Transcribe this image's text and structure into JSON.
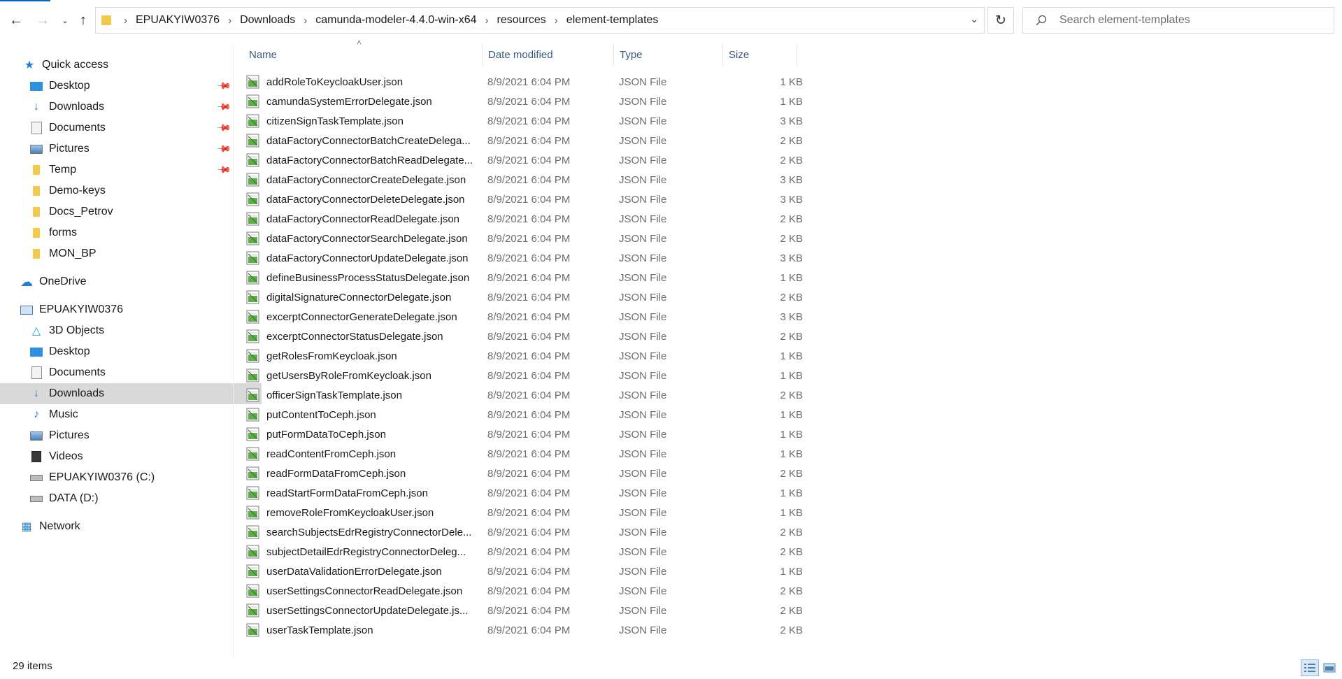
{
  "nav": {
    "back_icon": "arrow-left-icon",
    "forward_icon": "arrow-right-icon",
    "recent_icon": "chevron-down-icon",
    "up_icon": "arrow-up-icon"
  },
  "address": {
    "crumbs": [
      "EPUAKYIW0376",
      "Downloads",
      "camunda-modeler-4.4.0-win-x64",
      "resources",
      "element-templates"
    ]
  },
  "search": {
    "placeholder": "Search element-templates"
  },
  "sidebar": {
    "quick_access": "Quick access",
    "pinned": [
      {
        "label": "Desktop",
        "icon": "desktop-icon"
      },
      {
        "label": "Downloads",
        "icon": "downloads-icon"
      },
      {
        "label": "Documents",
        "icon": "documents-icon"
      },
      {
        "label": "Pictures",
        "icon": "pictures-icon"
      },
      {
        "label": "Temp",
        "icon": "folder-icon"
      }
    ],
    "folders": [
      {
        "label": "Demo-keys"
      },
      {
        "label": "Docs_Petrov"
      },
      {
        "label": "forms"
      },
      {
        "label": "MON_BP"
      }
    ],
    "onedrive": "OneDrive",
    "this_pc": "EPUAKYIW0376",
    "pc_items": [
      {
        "label": "3D Objects",
        "icon": "3d-objects-icon"
      },
      {
        "label": "Desktop",
        "icon": "desktop-icon"
      },
      {
        "label": "Documents",
        "icon": "documents-icon"
      },
      {
        "label": "Downloads",
        "icon": "downloads-icon"
      },
      {
        "label": "Music",
        "icon": "music-icon"
      },
      {
        "label": "Pictures",
        "icon": "pictures-icon"
      },
      {
        "label": "Videos",
        "icon": "videos-icon"
      },
      {
        "label": "EPUAKYIW0376 (C:)",
        "icon": "drive-c-icon"
      },
      {
        "label": "DATA (D:)",
        "icon": "drive-d-icon"
      }
    ],
    "network": "Network"
  },
  "columns": {
    "name": "Name",
    "date": "Date modified",
    "type": "Type",
    "size": "Size"
  },
  "files": [
    {
      "name": "addRoleToKeycloakUser.json",
      "date": "8/9/2021 6:04 PM",
      "type": "JSON File",
      "size": "1 KB"
    },
    {
      "name": "camundaSystemErrorDelegate.json",
      "date": "8/9/2021 6:04 PM",
      "type": "JSON File",
      "size": "1 KB"
    },
    {
      "name": "citizenSignTaskTemplate.json",
      "date": "8/9/2021 6:04 PM",
      "type": "JSON File",
      "size": "3 KB"
    },
    {
      "name": "dataFactoryConnectorBatchCreateDelega...",
      "date": "8/9/2021 6:04 PM",
      "type": "JSON File",
      "size": "2 KB"
    },
    {
      "name": "dataFactoryConnectorBatchReadDelegate...",
      "date": "8/9/2021 6:04 PM",
      "type": "JSON File",
      "size": "2 KB"
    },
    {
      "name": "dataFactoryConnectorCreateDelegate.json",
      "date": "8/9/2021 6:04 PM",
      "type": "JSON File",
      "size": "3 KB"
    },
    {
      "name": "dataFactoryConnectorDeleteDelegate.json",
      "date": "8/9/2021 6:04 PM",
      "type": "JSON File",
      "size": "3 KB"
    },
    {
      "name": "dataFactoryConnectorReadDelegate.json",
      "date": "8/9/2021 6:04 PM",
      "type": "JSON File",
      "size": "2 KB"
    },
    {
      "name": "dataFactoryConnectorSearchDelegate.json",
      "date": "8/9/2021 6:04 PM",
      "type": "JSON File",
      "size": "2 KB"
    },
    {
      "name": "dataFactoryConnectorUpdateDelegate.json",
      "date": "8/9/2021 6:04 PM",
      "type": "JSON File",
      "size": "3 KB"
    },
    {
      "name": "defineBusinessProcessStatusDelegate.json",
      "date": "8/9/2021 6:04 PM",
      "type": "JSON File",
      "size": "1 KB"
    },
    {
      "name": "digitalSignatureConnectorDelegate.json",
      "date": "8/9/2021 6:04 PM",
      "type": "JSON File",
      "size": "2 KB"
    },
    {
      "name": "excerptConnectorGenerateDelegate.json",
      "date": "8/9/2021 6:04 PM",
      "type": "JSON File",
      "size": "3 KB"
    },
    {
      "name": "excerptConnectorStatusDelegate.json",
      "date": "8/9/2021 6:04 PM",
      "type": "JSON File",
      "size": "2 KB"
    },
    {
      "name": "getRolesFromKeycloak.json",
      "date": "8/9/2021 6:04 PM",
      "type": "JSON File",
      "size": "1 KB"
    },
    {
      "name": "getUsersByRoleFromKeycloak.json",
      "date": "8/9/2021 6:04 PM",
      "type": "JSON File",
      "size": "1 KB"
    },
    {
      "name": "officerSignTaskTemplate.json",
      "date": "8/9/2021 6:04 PM",
      "type": "JSON File",
      "size": "2 KB"
    },
    {
      "name": "putContentToCeph.json",
      "date": "8/9/2021 6:04 PM",
      "type": "JSON File",
      "size": "1 KB"
    },
    {
      "name": "putFormDataToCeph.json",
      "date": "8/9/2021 6:04 PM",
      "type": "JSON File",
      "size": "1 KB"
    },
    {
      "name": "readContentFromCeph.json",
      "date": "8/9/2021 6:04 PM",
      "type": "JSON File",
      "size": "1 KB"
    },
    {
      "name": "readFormDataFromCeph.json",
      "date": "8/9/2021 6:04 PM",
      "type": "JSON File",
      "size": "2 KB"
    },
    {
      "name": "readStartFormDataFromCeph.json",
      "date": "8/9/2021 6:04 PM",
      "type": "JSON File",
      "size": "1 KB"
    },
    {
      "name": "removeRoleFromKeycloakUser.json",
      "date": "8/9/2021 6:04 PM",
      "type": "JSON File",
      "size": "1 KB"
    },
    {
      "name": "searchSubjectsEdrRegistryConnectorDele...",
      "date": "8/9/2021 6:04 PM",
      "type": "JSON File",
      "size": "2 KB"
    },
    {
      "name": "subjectDetailEdrRegistryConnectorDeleg...",
      "date": "8/9/2021 6:04 PM",
      "type": "JSON File",
      "size": "2 KB"
    },
    {
      "name": "userDataValidationErrorDelegate.json",
      "date": "8/9/2021 6:04 PM",
      "type": "JSON File",
      "size": "1 KB"
    },
    {
      "name": "userSettingsConnectorReadDelegate.json",
      "date": "8/9/2021 6:04 PM",
      "type": "JSON File",
      "size": "2 KB"
    },
    {
      "name": "userSettingsConnectorUpdateDelegate.js...",
      "date": "8/9/2021 6:04 PM",
      "type": "JSON File",
      "size": "2 KB"
    },
    {
      "name": "userTaskTemplate.json",
      "date": "8/9/2021 6:04 PM",
      "type": "JSON File",
      "size": "2 KB"
    }
  ],
  "status": {
    "items": "29 items"
  },
  "colors": {
    "accent": "#0a64c4",
    "selected": "#d9d9d9",
    "folder": "#f2c94c"
  }
}
